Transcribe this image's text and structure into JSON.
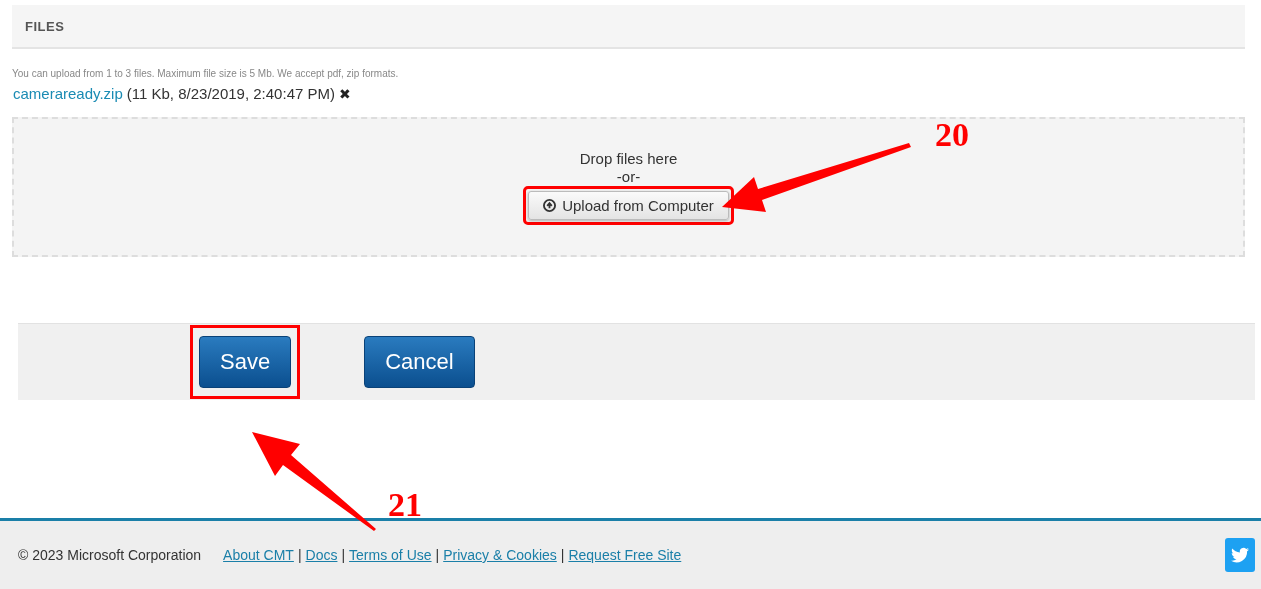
{
  "section": {
    "title": "FILES"
  },
  "hint": "You can upload from 1 to 3 files. Maximum file size is 5 Mb. We accept pdf, zip formats.",
  "file": {
    "name": "cameraready.zip",
    "details": "(11 Kb, 8/23/2019, 2:40:47 PM)",
    "remove": "✖"
  },
  "dropzone": {
    "text": "Drop files here",
    "separator": "-or-",
    "button": {
      "label": "Upload from Computer",
      "highlighted": true
    }
  },
  "buttons": [
    {
      "label": "Save",
      "highlighted": true
    },
    {
      "label": "Cancel",
      "highlighted": false
    }
  ],
  "footer": {
    "copyright": "© 2023 Microsoft Corporation",
    "separator": "|",
    "links": [
      "About CMT",
      "Docs",
      "Terms of Use",
      "Privacy & Cookies",
      "Request Free Site"
    ]
  },
  "annotations": [
    {
      "label": "20"
    },
    {
      "label": "21"
    }
  ]
}
